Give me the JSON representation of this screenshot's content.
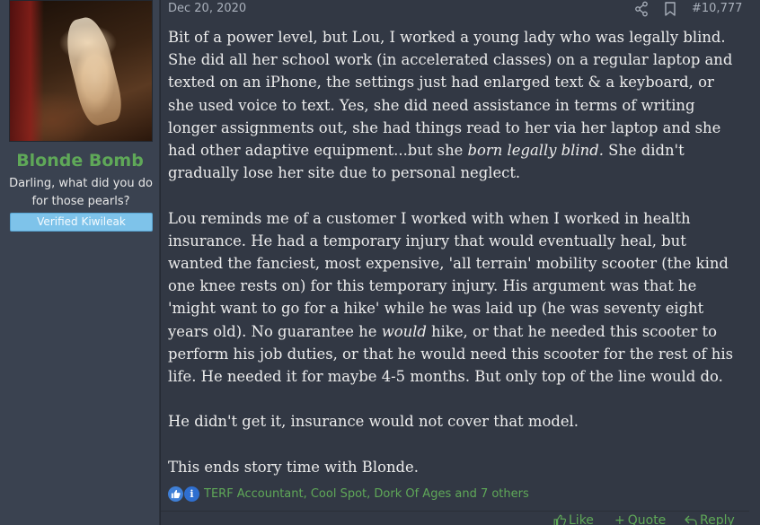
{
  "user": {
    "name": "Blonde Bomb",
    "title": "Darling, what did you do for those pearls?",
    "banner": "Verified Kiwileak",
    "avatar_icon": "avatar-image"
  },
  "post": {
    "date": "Dec 20, 2020",
    "number": "#10,777",
    "paragraphs": {
      "p1_a": "Bit of a power level, but Lou, I worked a young lady who was legally blind. She did all her school work (in accelerated classes) on a regular laptop and texted on an iPhone, the settings just had enlarged text & a keyboard, or she used voice to text. Yes, she did need assistance in terms of writing longer assignments out, she had things read to her via her laptop and she had other adaptive equipment...but she ",
      "p1_em": "born legally blind.",
      "p1_b": " She didn't gradually lose her site due to personal neglect.",
      "p2_a": "Lou reminds me of a customer I worked with when I worked in health insurance. He had a temporary injury that would eventually heal, but wanted the fanciest, most expensive, 'all terrain' mobility scooter (the kind one knee rests on) for this temporary injury. His argument was that he 'might want to go for a hike' while he was laid up (he was seventy eight years old). No guarantee he ",
      "p2_em": "would",
      "p2_b": " hike, or that he needed this scooter to perform his job duties, or that he would need this scooter for the rest of his life. He needed it for maybe 4-5 months. But only top of the line would do.",
      "p3": "He didn't get it, insurance would not cover that model.",
      "p4": "This ends story time with Blonde."
    },
    "reactions_text": "TERF Accountant, Cool Spot, Dork Of Ages and 7 others",
    "actions": {
      "like": "Like",
      "quote": "Quote",
      "reply": "Reply"
    }
  },
  "colors": {
    "accent_green": "#5fa858",
    "banner_blue": "#7ec3ea",
    "sidebar_bg": "#3a4250",
    "message_bg": "#323844"
  },
  "icons": {
    "share": "share-icon",
    "bookmark": "bookmark-icon",
    "like_reaction": "thumbs-up-icon",
    "info_reaction": "info-icon"
  }
}
